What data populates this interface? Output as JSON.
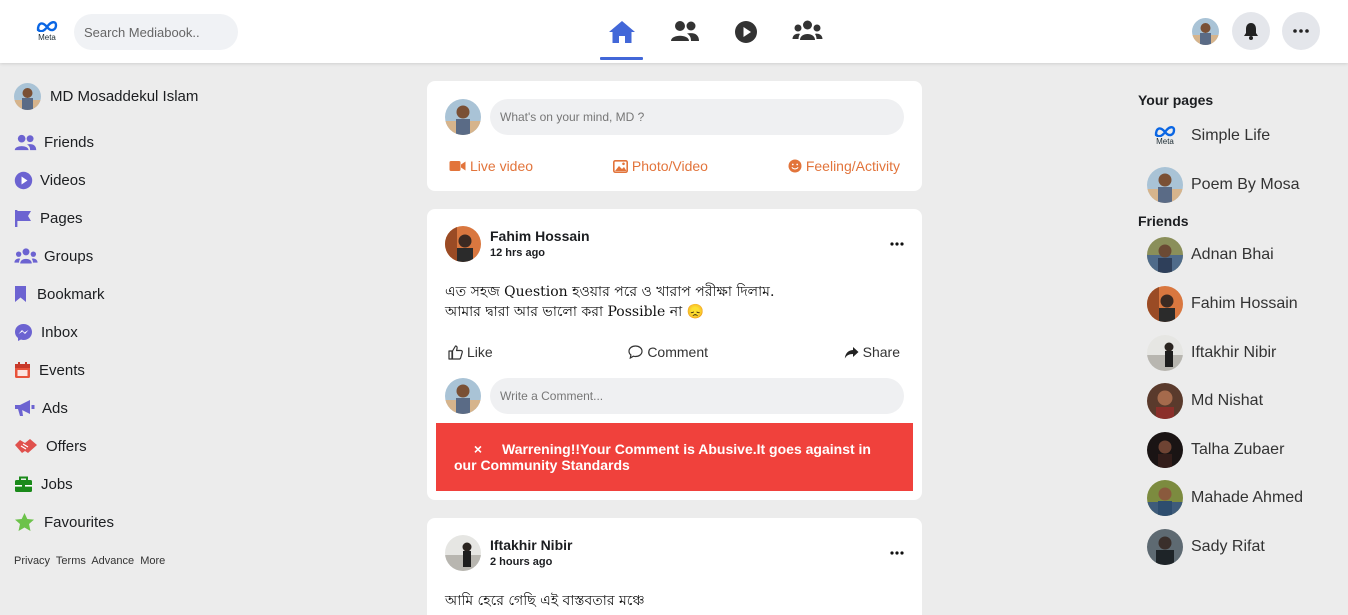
{
  "header": {
    "logo_text": "Meta",
    "search_placeholder": "Search Mediabook..",
    "nav": [
      {
        "name": "home",
        "icon": "home-icon",
        "active": true
      },
      {
        "name": "friends",
        "icon": "friends-icon",
        "active": false
      },
      {
        "name": "watch",
        "icon": "play-icon",
        "active": false
      },
      {
        "name": "groups",
        "icon": "groups-icon",
        "active": false
      }
    ],
    "accent_color": "#4267d8"
  },
  "left_sidebar": {
    "profile_name": "MD Mosaddekul Islam",
    "items": [
      {
        "label": "Friends",
        "icon": "friends-icon",
        "color": "#6c63d1"
      },
      {
        "label": "Videos",
        "icon": "video-play-icon",
        "color": "#6c63d1"
      },
      {
        "label": "Pages",
        "icon": "flag-icon",
        "color": "#6c63d1"
      },
      {
        "label": "Groups",
        "icon": "groups-icon",
        "color": "#6c63d1"
      },
      {
        "label": "Bookmark",
        "icon": "bookmark-icon",
        "color": "#6c63d1"
      },
      {
        "label": "Inbox",
        "icon": "messenger-icon",
        "color": "#6c63d1"
      },
      {
        "label": "Events",
        "icon": "calendar-icon",
        "color": "#e8533b"
      },
      {
        "label": "Ads",
        "icon": "megaphone-icon",
        "color": "#6c63d1"
      },
      {
        "label": "Offers",
        "icon": "handshake-icon",
        "color": "#e0514d"
      },
      {
        "label": "Jobs",
        "icon": "briefcase-icon",
        "color": "#1a8a1a"
      },
      {
        "label": "Favourites",
        "icon": "star-icon",
        "color": "#6cc24a"
      }
    ],
    "footer": [
      "Privacy",
      "Terms",
      "Advance",
      "More"
    ]
  },
  "composer": {
    "placeholder": "What's on your mind, MD ?",
    "actions": [
      {
        "label": "Live video",
        "icon": "video-camera-icon"
      },
      {
        "label": "Photo/Video",
        "icon": "photo-icon"
      },
      {
        "label": "Feeling/Activity",
        "icon": "smiley-icon"
      }
    ],
    "action_color": "#e2743b"
  },
  "posts": [
    {
      "author": "Fahim Hossain",
      "time": "12 hrs ago",
      "text": "এত সহজ Question হওয়ার পরে ও খারাপ পরীক্ষা দিলাম.\nআমার দ্বারা আর ভালো করা Possible না 😞",
      "actions": {
        "like": "Like",
        "comment": "Comment",
        "share": "Share"
      },
      "comment_placeholder": "Write a Comment...",
      "warning": {
        "close": "×",
        "message": "Warrening!!Your Comment is Abusive.It goes against in our Community Standards",
        "color": "#f0413c"
      }
    },
    {
      "author": "Iftakhir Nibir",
      "time": "2 hours ago",
      "text": "আমি হেরে গেছি এই বাস্তবতার মঞ্চে"
    }
  ],
  "right_sidebar": {
    "pages_heading": "Your pages",
    "pages": [
      {
        "name": "Simple Life",
        "icon": "meta-logo-icon"
      },
      {
        "name": "Poem By Mosa",
        "icon": "avatar"
      }
    ],
    "friends_heading": "Friends",
    "friends": [
      {
        "name": "Adnan Bhai"
      },
      {
        "name": "Fahim Hossain"
      },
      {
        "name": "Iftakhir Nibir"
      },
      {
        "name": "Md Nishat"
      },
      {
        "name": "Talha Zubaer"
      },
      {
        "name": "Mahade Ahmed"
      },
      {
        "name": "Sady Rifat"
      }
    ]
  }
}
